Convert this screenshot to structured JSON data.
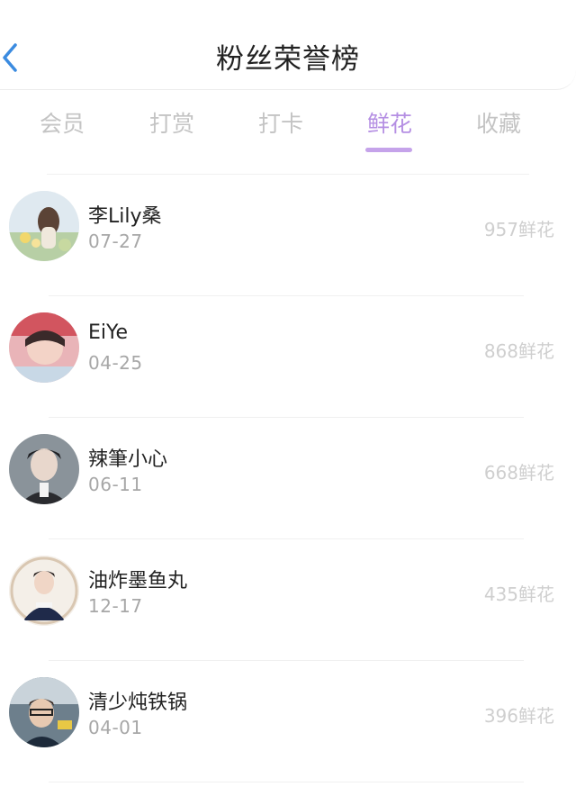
{
  "header": {
    "title": "粉丝荣誉榜"
  },
  "tabs": [
    {
      "label": "会员",
      "active": false
    },
    {
      "label": "打赏",
      "active": false
    },
    {
      "label": "打卡",
      "active": false
    },
    {
      "label": "鲜花",
      "active": true
    },
    {
      "label": "收藏",
      "active": false
    }
  ],
  "colors": {
    "accent": "#b58fe3",
    "underline": "#c5a3ea",
    "muted": "#c4c4c4"
  },
  "fans": [
    {
      "name": "李Lily桑",
      "date": "07-27",
      "count": "957鲜花"
    },
    {
      "name": "EiYe",
      "date": "04-25",
      "count": "868鲜花"
    },
    {
      "name": "辣筆小心",
      "date": "06-11",
      "count": "668鲜花"
    },
    {
      "name": "油炸墨鱼丸",
      "date": "12-17",
      "count": "435鲜花"
    },
    {
      "name": "清少炖铁锅",
      "date": "04-01",
      "count": "396鲜花"
    }
  ]
}
